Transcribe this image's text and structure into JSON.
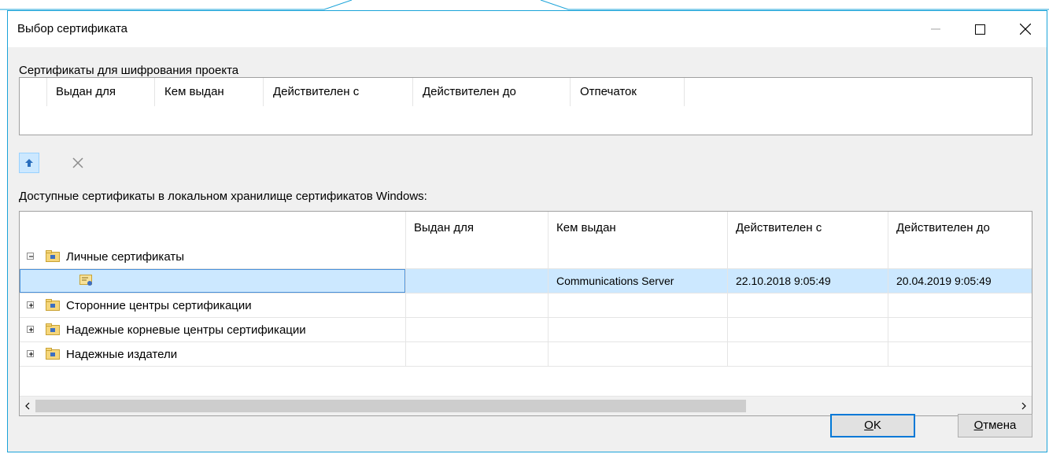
{
  "window": {
    "title": "Выбор сертификата"
  },
  "controls": {
    "minimize": "minimize",
    "maximize": "maximize",
    "close": "close"
  },
  "encryption": {
    "label": "Сертификаты для шифрования проекта",
    "columns": [
      "Выдан для",
      "Кем выдан",
      "Действителен с",
      "Действителен до",
      "Отпечаток"
    ]
  },
  "toolbar": {
    "move_up_icon": "arrow-up-icon",
    "remove_icon": "x-icon"
  },
  "available": {
    "label": "Доступные сертификаты в локальном хранилище сертификатов Windows:",
    "columns": [
      "",
      "Выдан для",
      "Кем выдан",
      "Действителен с",
      "Действителен до"
    ],
    "rows": [
      {
        "type": "group",
        "expanded": true,
        "label": "Личные сертификаты",
        "cells": [
          "",
          "",
          "",
          ""
        ]
      },
      {
        "type": "item",
        "selected": true,
        "label": "",
        "cells": [
          "",
          "Communications Server",
          "22.10.2018 9:05:49",
          "20.04.2019 9:05:49"
        ]
      },
      {
        "type": "group",
        "expanded": false,
        "label": "Сторонние центры сертификации",
        "cells": [
          "",
          "",
          "",
          ""
        ]
      },
      {
        "type": "group",
        "expanded": false,
        "label": "Надежные корневые центры сертификации",
        "cells": [
          "",
          "",
          "",
          ""
        ]
      },
      {
        "type": "group",
        "expanded": false,
        "label": "Надежные издатели",
        "cells": [
          "",
          "",
          "",
          ""
        ]
      }
    ]
  },
  "buttons": {
    "ok": {
      "accel": "O",
      "rest": "K"
    },
    "cancel": {
      "accel": "О",
      "rest": "тмена"
    }
  },
  "colors": {
    "accent": "#0078d7",
    "selection": "#cce8ff",
    "window_border": "#1aa3d9"
  }
}
